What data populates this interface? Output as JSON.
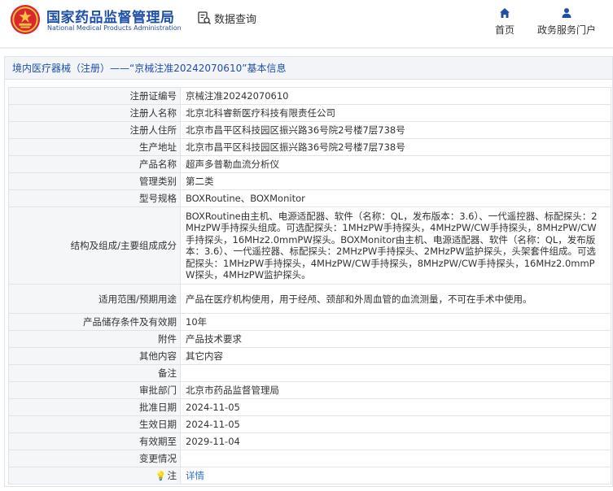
{
  "header": {
    "brand_cn": "国家药品监督管理局",
    "brand_en": "National Medical Products Administration",
    "query_label": "数据查询",
    "nav": [
      {
        "label": "首页",
        "icon": "home-icon"
      },
      {
        "label": "政务服务门户",
        "icon": "user-icon"
      }
    ]
  },
  "panel": {
    "category": "境内医疗器械（注册）",
    "dash": "——",
    "reg_quoted": "“京械注准20242070610”",
    "suffix": "基本信息"
  },
  "rows": [
    {
      "key": "注册证编号",
      "value": "京械注准20242070610"
    },
    {
      "key": "注册人名称",
      "value": "北京北科睿新医疗科技有限责任公司"
    },
    {
      "key": "注册人住所",
      "value": "北京市昌平区科技园区振兴路36号院2号楼7层738号"
    },
    {
      "key": "生产地址",
      "value": "北京市昌平区科技园区振兴路36号院2号楼7层738号"
    },
    {
      "key": "产品名称",
      "value": "超声多普勒血流分析仪"
    },
    {
      "key": "管理类别",
      "value": "第二类"
    },
    {
      "key": "型号规格",
      "value": "BOXRoutine、BOXMonitor"
    },
    {
      "key": "结构及组成/主要组成成分",
      "value": "BOXRoutine由主机、电源适配器、软件（名称：QL，发布版本：3.6）、一代遥控器、标配探头：2MHzPW手持探头组成。可选配探头：1MHzPW手持探头，4MHzPW/CW手持探头，8MHzPW/CW手持探头，16MHz2.0mmPW探头。BOXMonitor由主机、电源适配器、软件（名称：QL，发布版本：3.6）、一代遥控器、标配探头：2MHzPW手持探头、2MHzPW监护探头，头架套件组成。可选配探头：1MHzPW手持探头，4MHzPW/CW手持探头，8MHzPW/CW手持探头，16MHz2.0mmPW探头，4MHzPW监护探头。"
    },
    {
      "key": "适用范围/预期用途",
      "value": "产品在医疗机构使用，用于经颅、颈部和外周血管的血流测量，不可在手术中使用。"
    },
    {
      "key": "产品储存条件及有效期",
      "value": "10年"
    },
    {
      "key": "附件",
      "value": "产品技术要求"
    },
    {
      "key": "其他内容",
      "value": "其它内容"
    },
    {
      "key": "备注",
      "value": ""
    },
    {
      "key": "审批部门",
      "value": "北京市药品监督管理局"
    },
    {
      "key": "批准日期",
      "value": "2024-11-05"
    },
    {
      "key": "生效日期",
      "value": "2024-11-05"
    },
    {
      "key": "有效期至",
      "value": "2029-11-04"
    },
    {
      "key": "变更情况",
      "value": ""
    },
    {
      "key": "注",
      "value": "详情"
    }
  ],
  "colors": {
    "brand": "#1f50a8",
    "link": "#2a6fd6",
    "label_bg": "#f5f6f8",
    "border": "#dfe4ec"
  }
}
